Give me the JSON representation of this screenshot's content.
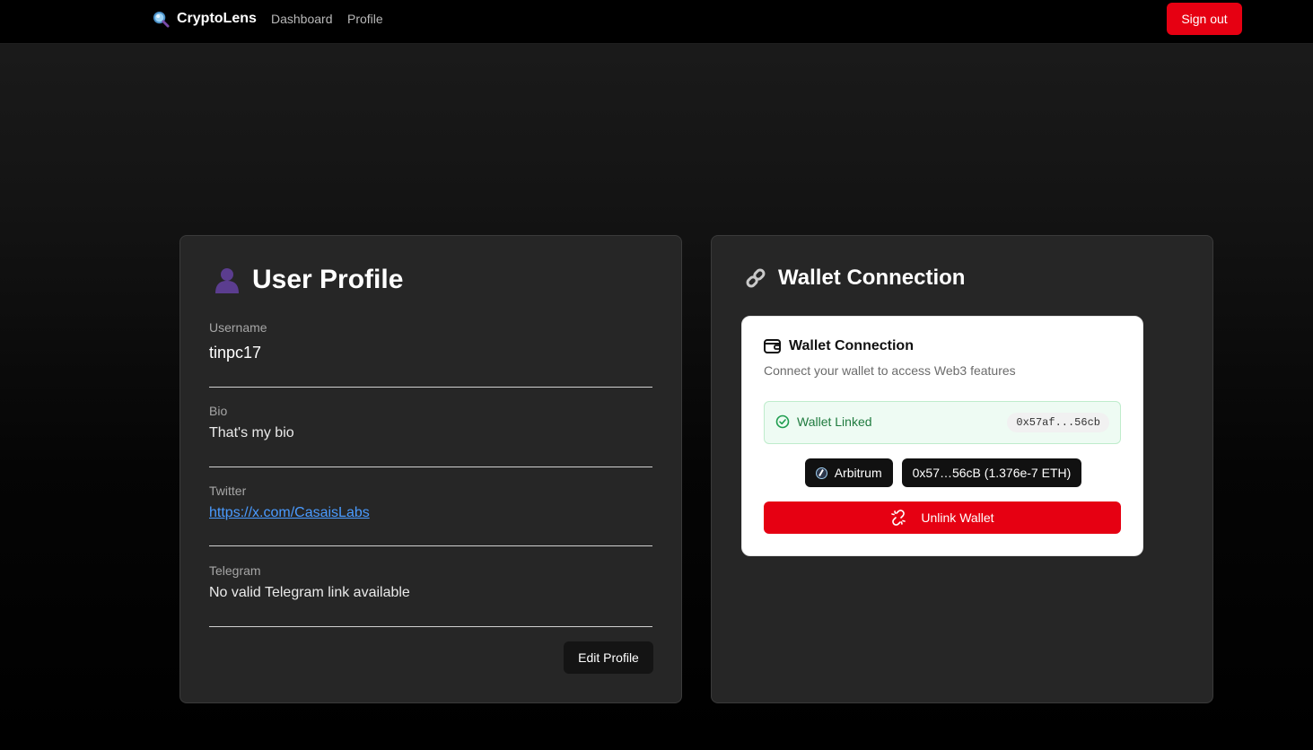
{
  "nav": {
    "brand": "CryptoLens",
    "brand_icon": "magnifier-icon",
    "links": [
      "Dashboard",
      "Profile"
    ],
    "signout_label": "Sign out"
  },
  "profile": {
    "title": "User Profile",
    "title_icon": "user-silhouette-icon",
    "fields": {
      "username": {
        "label": "Username",
        "value": "tinpc17"
      },
      "bio": {
        "label": "Bio",
        "value": "That's my bio"
      },
      "twitter": {
        "label": "Twitter",
        "value": "https://x.com/CasaisLabs"
      },
      "telegram": {
        "label": "Telegram",
        "value": "No valid Telegram link available"
      }
    },
    "edit_label": "Edit Profile"
  },
  "wallet": {
    "title": "Wallet Connection",
    "title_icon": "link-icon",
    "panel": {
      "title": "Wallet Connection",
      "subtitle": "Connect your wallet to access Web3 features",
      "status": "Wallet Linked",
      "address_short": "0x57af...56cb",
      "network": "Arbitrum",
      "account": "0x57…56cB (1.376e-7 ETH)",
      "unlink_label": "Unlink Wallet"
    }
  },
  "colors": {
    "accent_red": "#e60012",
    "link_blue": "#4a9bff",
    "success_green": "#1f7a3e"
  }
}
